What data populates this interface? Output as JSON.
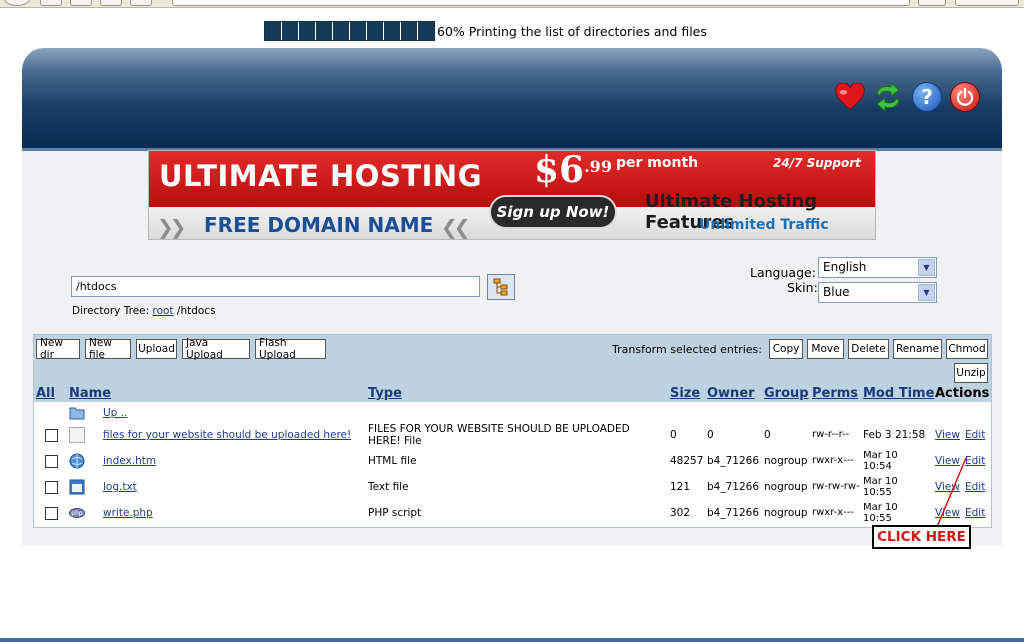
{
  "progress": {
    "percent": 60,
    "blocks_filled": 10,
    "text": "60% Printing the list of directories and files"
  },
  "header_icons": [
    "heart-icon",
    "refresh-icon",
    "help-icon",
    "power-icon"
  ],
  "banner": {
    "title": "ULTIMATE HOSTING",
    "price": "$6",
    "price_cents": ".99",
    "per_month": "per month",
    "support": "24/7 Support",
    "domain": "FREE DOMAIN NAME",
    "signup": "Sign up Now!",
    "features": "Ultimate Hosting Features",
    "traffic": "Unlimited Traffic"
  },
  "path": {
    "value": "/htdocs"
  },
  "directory_tree": {
    "label": "Directory Tree:",
    "root_link": "root",
    "rest": "/htdocs"
  },
  "settings": {
    "language_label": "Language:",
    "language_value": "English",
    "skin_label": "Skin:",
    "skin_value": "Blue"
  },
  "toolbar": {
    "left_buttons": [
      "New dir",
      "New file",
      "Upload",
      "Java Upload",
      "Flash Upload"
    ],
    "transform_label": "Transform selected entries:",
    "right_buttons": [
      "Copy",
      "Move",
      "Delete",
      "Rename",
      "Chmod"
    ],
    "unzip": "Unzip"
  },
  "table": {
    "headers": [
      "All",
      "Name",
      "Type",
      "Size",
      "Owner",
      "Group",
      "Perms",
      "Mod Time",
      "Actions"
    ],
    "up_label": "Up ..",
    "rows": [
      {
        "name": "files for your website should be uploaded here!",
        "type": "FILES FOR YOUR WEBSITE SHOULD BE UPLOADED HERE! File",
        "size": "0",
        "owner": "0",
        "group": "0",
        "perms": "rw-r--r--",
        "modtime": "Feb 3 21:58",
        "view": "View",
        "edit": "Edit",
        "icon": "blank-file-icon"
      },
      {
        "name": "index.htm",
        "type": "HTML file",
        "size": "48257",
        "owner": "b4_71266",
        "group": "nogroup",
        "perms": "rwxr-x---",
        "modtime": "Mar 10 10:54",
        "view": "View",
        "edit": "Edit",
        "icon": "html-file-icon"
      },
      {
        "name": "log.txt",
        "type": "Text file",
        "size": "121",
        "owner": "b4_71266",
        "group": "nogroup",
        "perms": "rw-rw-rw-",
        "modtime": "Mar 10 10:55",
        "view": "View",
        "edit": "Edit",
        "icon": "text-file-icon"
      },
      {
        "name": "write.php",
        "type": "PHP script",
        "size": "302",
        "owner": "b4_71266",
        "group": "nogroup",
        "perms": "rwxr-x---",
        "modtime": "Mar 10 10:55",
        "view": "View",
        "edit": "Edit",
        "icon": "php-file-icon"
      }
    ]
  },
  "annotation": {
    "text": "CLICK HERE"
  },
  "colors": {
    "header_dark": "#0b2c52",
    "progress_block": "#153a58",
    "toolbar_bg": "#bdd2e1",
    "annotation_red": "#d61414"
  }
}
